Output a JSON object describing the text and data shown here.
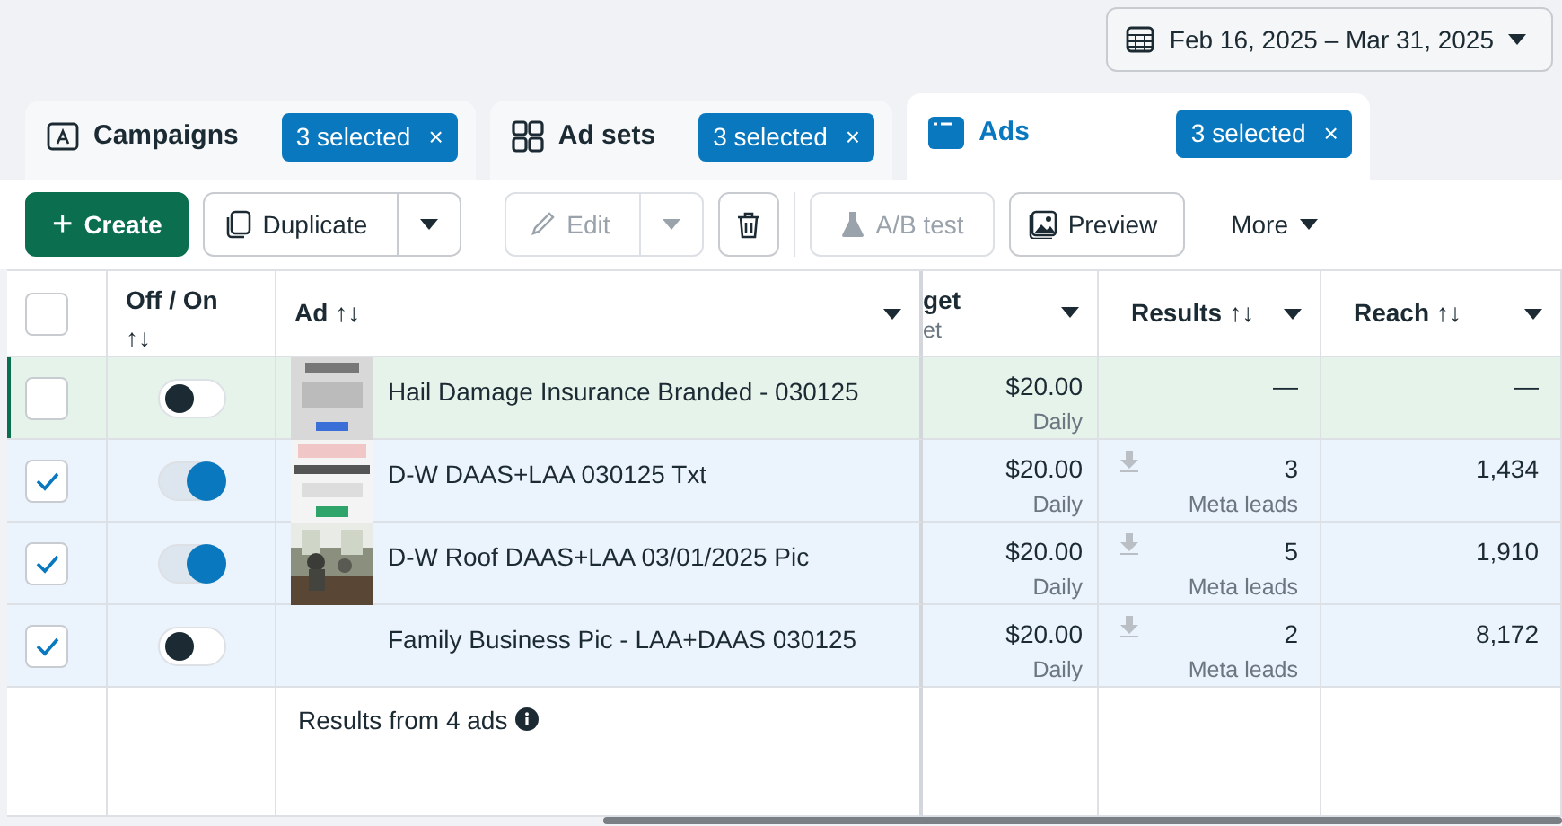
{
  "date_range": {
    "label": "Feb 16, 2025 – Mar 31, 2025"
  },
  "tabs": [
    {
      "label": "Campaigns",
      "badge": "3 selected",
      "clear": "×",
      "selected": false
    },
    {
      "label": "Ad sets",
      "badge": "3 selected",
      "clear": "×",
      "selected": false
    },
    {
      "label": "Ads",
      "badge": "3 selected",
      "clear": "×",
      "selected": true
    }
  ],
  "toolbar": {
    "create": "Create",
    "create_plus": "+",
    "duplicate": "Duplicate",
    "edit": "Edit",
    "edit_disabled": true,
    "ab_test": "A/B test",
    "ab_test_disabled": true,
    "preview": "Preview",
    "more": "More"
  },
  "table": {
    "columns": [
      {
        "kind": "check",
        "checked": false
      },
      {
        "label": "Off / On",
        "sort": "↑↓",
        "kind": "toggle"
      },
      {
        "label": "Ad",
        "sort": "↑↓",
        "kind": "ad"
      },
      {
        "label": "get",
        "sublabel": "et",
        "kind": "budget"
      },
      {
        "label": "Results",
        "sort": "↑↓",
        "kind": "results"
      },
      {
        "label": "Reach",
        "sort": "↑↓",
        "kind": "reach"
      }
    ],
    "rows": [
      {
        "checked": false,
        "highlighted": true,
        "on": false,
        "thumbnail": true,
        "name": "Hail Damage Insurance Branded - 030125",
        "budget": "$20.00",
        "budget_type": "Daily",
        "results": "—",
        "reach": "—"
      },
      {
        "checked": true,
        "highlighted": false,
        "on": true,
        "thumbnail": true,
        "name": "D-W DAAS+LAA 030125 Txt",
        "budget": "$20.00",
        "budget_type": "Daily",
        "results": "3",
        "result_type": "Meta leads",
        "reach": "1,434"
      },
      {
        "checked": true,
        "highlighted": false,
        "on": true,
        "thumbnail": true,
        "name": "D-W Roof DAAS+LAA 03/01/2025 Pic",
        "budget": "$20.00",
        "budget_type": "Daily",
        "results": "5",
        "result_type": "Meta leads",
        "reach": "1,910"
      },
      {
        "checked": true,
        "highlighted": false,
        "on": false,
        "thumbnail": false,
        "name": "Family Business Pic - LAA+DAAS 030125",
        "budget": "$20.00",
        "budget_type": "Daily",
        "results": "2",
        "result_type": "Meta leads",
        "reach": "8,172"
      }
    ],
    "summary": "Results from 4 ads"
  }
}
